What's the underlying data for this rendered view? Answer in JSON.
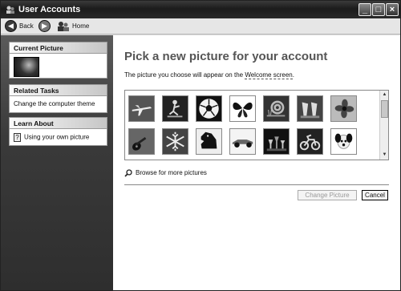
{
  "window": {
    "title": "User Accounts"
  },
  "toolbar": {
    "back_label": "Back",
    "home_label": "Home"
  },
  "sidebar": {
    "current_picture": {
      "title": "Current Picture"
    },
    "related_tasks": {
      "title": "Related Tasks",
      "items": [
        {
          "label": "Change the computer theme"
        }
      ]
    },
    "learn_about": {
      "title": "Learn About",
      "items": [
        {
          "label": "Using your own picture"
        }
      ]
    }
  },
  "main": {
    "heading": "Pick a new picture for your account",
    "description_prefix": "The picture you choose will appear on the ",
    "description_link": "Welcome screen",
    "description_suffix": ".",
    "pictures": [
      {
        "icon": "airplane-icon"
      },
      {
        "icon": "skateboarder-icon"
      },
      {
        "icon": "soccer-ball-icon"
      },
      {
        "icon": "butterfly-icon"
      },
      {
        "icon": "snail-icon"
      },
      {
        "icon": "beach-chairs-icon"
      },
      {
        "icon": "flower-icon"
      },
      {
        "icon": "guitar-icon"
      },
      {
        "icon": "snowflake-icon"
      },
      {
        "icon": "horse-icon"
      },
      {
        "icon": "race-car-icon"
      },
      {
        "icon": "chess-icon"
      },
      {
        "icon": "dirt-bike-icon"
      },
      {
        "icon": "dog-icon"
      }
    ],
    "browse_label": "Browse for more pictures",
    "change_button": "Change Picture",
    "cancel_button": "Cancel"
  }
}
